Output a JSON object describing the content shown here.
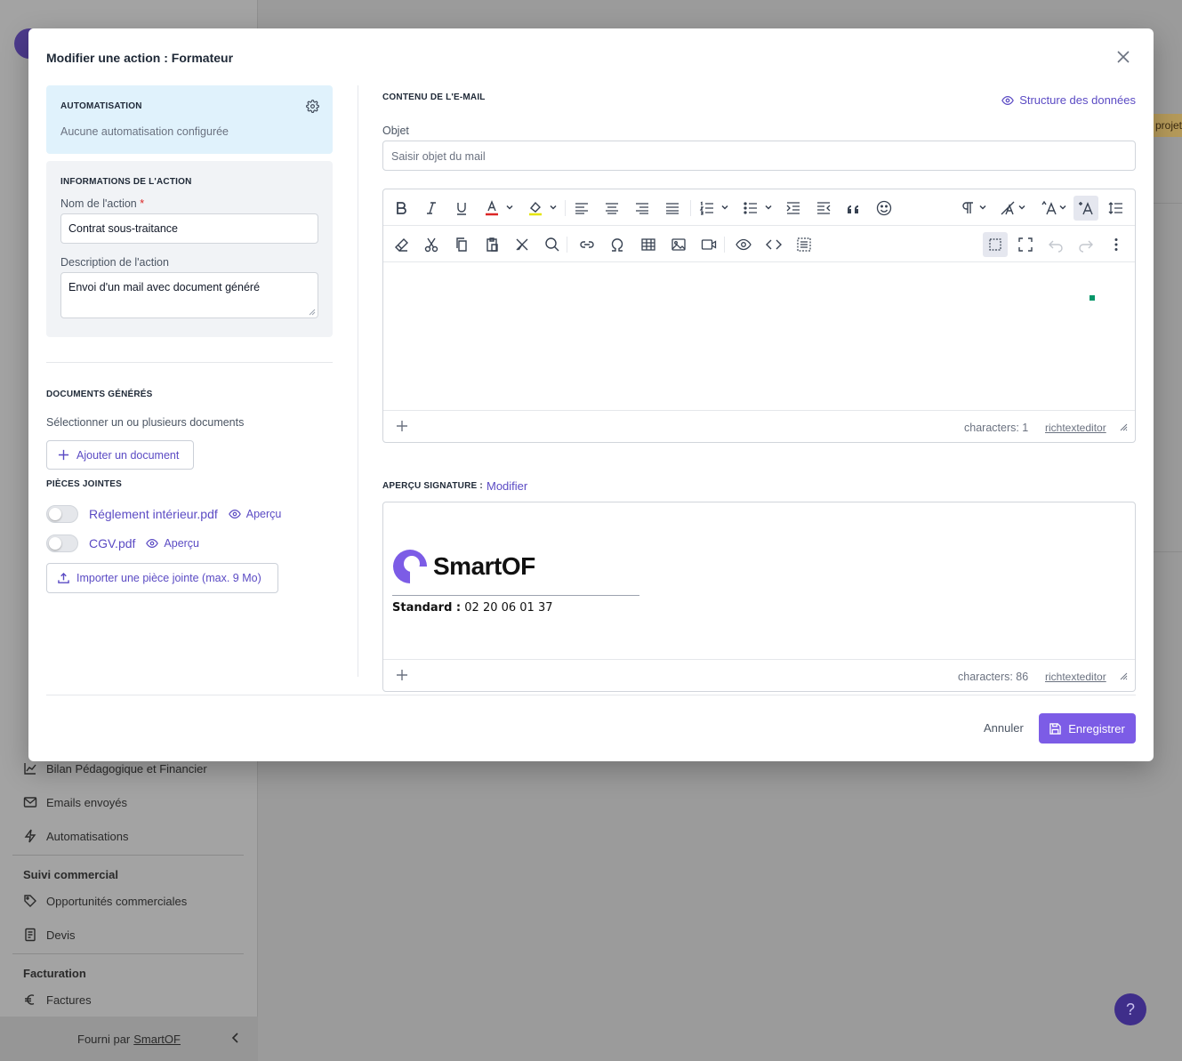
{
  "background": {
    "sidebar_sections": [
      {
        "label": "Suivi commercial"
      },
      {
        "label": "Facturation"
      }
    ],
    "sidebar_items": [
      {
        "label": "Bilan Pédagogique et Financier",
        "icon": "chart-line-icon"
      },
      {
        "label": "Emails envoyés",
        "icon": "mail-icon"
      },
      {
        "label": "Automatisations",
        "icon": "bolt-icon"
      },
      {
        "label": "Opportunités commerciales",
        "icon": "tag-icon"
      },
      {
        "label": "Devis",
        "icon": "document-icon"
      },
      {
        "label": "Factures",
        "icon": "euro-icon"
      }
    ],
    "footer": {
      "prefix": "Fourni par",
      "brand": "SmartOF"
    },
    "tag_fragment": "projet",
    "help_label": "?"
  },
  "modal": {
    "title": "Modifier une action : Formateur",
    "automation": {
      "title": "AUTOMATISATION",
      "status": "Aucune automatisation configurée"
    },
    "info": {
      "title": "INFORMATIONS DE L'ACTION",
      "name_label": "Nom de l'action",
      "required_mark": "*",
      "name_value": "Contrat sous-traitance",
      "desc_label": "Description de l'action",
      "desc_value": "Envoi d'un mail avec document généré"
    },
    "documents": {
      "title": "DOCUMENTS GÉNÉRÉS",
      "subtitle": "Sélectionner un ou plusieurs documents",
      "add_label": "Ajouter un document"
    },
    "attachments": {
      "title": "PIÈCES JOINTES",
      "items": [
        {
          "name": "Réglement intérieur.pdf",
          "preview": "Aperçu",
          "enabled": false
        },
        {
          "name": "CGV.pdf",
          "preview": "Aperçu",
          "enabled": false
        }
      ],
      "import_label": "Importer une pièce jointe (max. 9 Mo)"
    },
    "mail": {
      "title": "CONTENU DE L'E-MAIL",
      "structure_link": "Structure des données",
      "subject_label": "Objet",
      "subject_placeholder": "Saisir objet du mail",
      "char_count": "characters: 1",
      "editor_link": "richtexteditor"
    },
    "signature": {
      "label": "APERÇU SIGNATURE :",
      "edit_link": "Modifier",
      "logo_text": "SmartOF",
      "phone_label": "Standard :",
      "phone_value": "02 20 06 01 37",
      "char_count": "characters: 86",
      "editor_link": "richtexteditor"
    },
    "actions": {
      "cancel": "Annuler",
      "save": "Enregistrer"
    },
    "colors": {
      "accent": "#7c5ce6",
      "link": "#5b4bc4",
      "automation_bg": "#e0f2fc",
      "info_bg": "#f1f3f6"
    }
  }
}
